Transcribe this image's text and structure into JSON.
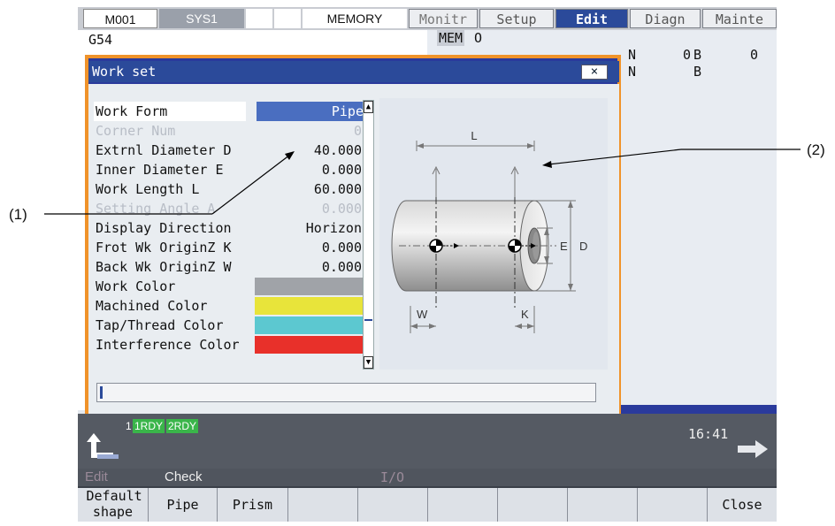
{
  "topbar": {
    "cells": [
      "M001",
      "SYS1",
      "",
      "",
      "MEMORY"
    ],
    "tabs": [
      "Monitr",
      "Setup",
      "Edit",
      "Diagn",
      "Mainte"
    ],
    "active_tab": "Edit"
  },
  "background": {
    "program": "G54",
    "mode": "MEM",
    "prog": "O",
    "n_label": "N",
    "n_value": "0",
    "b_label": "B",
    "b_value": "0",
    "n2_label": "N",
    "b2_label": "B"
  },
  "dialog": {
    "title": "Work set",
    "close_glyph": "×",
    "rows": [
      {
        "label": "Work Form",
        "value": "Pipe"
      },
      {
        "label": "Corner Num",
        "value": "0"
      },
      {
        "label": "Extrnl Diameter D",
        "value": "40.000"
      },
      {
        "label": "Inner Diameter E",
        "value": "0.000"
      },
      {
        "label": "Work Length L",
        "value": "60.000"
      },
      {
        "label": "Setting Angle A",
        "value": "0.000"
      },
      {
        "label": "Display Direction",
        "value": "Horizon"
      },
      {
        "label": "Frot Wk OriginZ K",
        "value": "0.000"
      },
      {
        "label": "Back Wk OriginZ W",
        "value": "0.000"
      },
      {
        "label": "Work Color",
        "value": ""
      },
      {
        "label": "Machined Color",
        "value": ""
      },
      {
        "label": "Tap/Thread Color",
        "value": ""
      },
      {
        "label": "Interference Color",
        "value": ""
      }
    ],
    "colors": {
      "work": "#a0a3a8",
      "machined": "#e8e43a",
      "tap_thread": "#5cc8d0",
      "interference": "#e8302a",
      "selected": "#4a6ec0"
    },
    "diagram": {
      "L": "L",
      "D": "D",
      "E": "E",
      "W": "W",
      "K": "K"
    }
  },
  "status": {
    "rdy1": "1RDY",
    "rdy2": "2RDY",
    "clock": "16:41"
  },
  "fkeys": {
    "edit": "Edit",
    "check": "Check",
    "io": "I/O"
  },
  "menu": [
    "Default shape",
    "Pipe",
    "Prism",
    "",
    "",
    "",
    "",
    "",
    "",
    "Close"
  ],
  "annotations": {
    "a1": "(1)",
    "a2": "(2)"
  }
}
